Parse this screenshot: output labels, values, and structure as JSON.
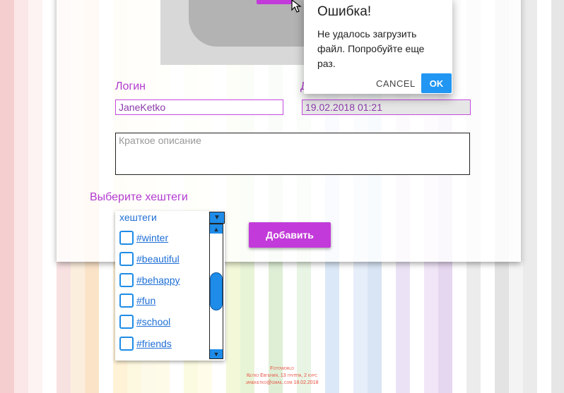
{
  "form": {
    "login_label": "Логин",
    "login_value": "JaneKetko",
    "date_label_partial": "Д",
    "date_value": "19.02.2018 01:21",
    "description_placeholder": "Краткое описание",
    "hashtags_label": "Выберите хештеги",
    "add_button": "Добавить"
  },
  "hashtags": {
    "header": "хештеги",
    "items": [
      "#winter",
      "#beautiful",
      "#behappy",
      "#fun",
      "#school",
      "#friends"
    ]
  },
  "dialog": {
    "title": "Ошибка!",
    "message": "Не удалось загрузить файл. Попробуйте еще раз.",
    "cancel": "CANCEL",
    "ok": "OK"
  },
  "footer": {
    "line1": "Fotoworld",
    "line2": "Кетко Евгения, 13 группа, 2 курс",
    "line3": "janeketko@gmail.com 18.02.2018"
  },
  "colors": {
    "accent": "#c23ad9",
    "link": "#1e6fd6",
    "dialog_ok": "#2196f3"
  }
}
